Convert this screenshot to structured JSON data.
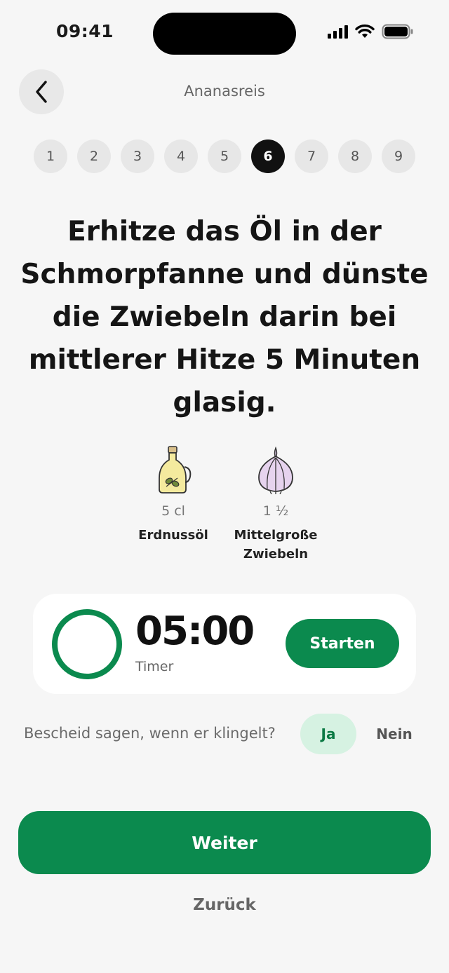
{
  "status_bar": {
    "time": "09:41",
    "icons": [
      "cellular-signal-icon",
      "wifi-icon",
      "battery-icon"
    ]
  },
  "header": {
    "back_icon": "chevron-left-icon",
    "title": "Ananasreis"
  },
  "steps": {
    "items": [
      "1",
      "2",
      "3",
      "4",
      "5",
      "6",
      "7",
      "8",
      "9"
    ],
    "active": "6"
  },
  "instruction": "Erhitze das Öl in der Schmorpfanne und dünste die Zwiebeln darin bei mittlerer Hitze 5 Minuten glasig.",
  "ingredients": [
    {
      "icon": "oil-bottle-icon",
      "quantity": "5 cl",
      "name": "Erdnussöl"
    },
    {
      "icon": "onion-icon",
      "quantity": "1 ½",
      "name": "Mittelgroße Zwiebeln"
    }
  ],
  "timer": {
    "value": "05:00",
    "label": "Timer",
    "start_label": "Starten"
  },
  "notify": {
    "question": "Bescheid sagen, wenn er klingelt?",
    "yes_label": "Ja",
    "no_label": "Nein"
  },
  "footer": {
    "next_label": "Weiter",
    "back_label": "Zurück"
  },
  "colors": {
    "accent": "#0b8a4e",
    "accent_light": "#d6f2e2",
    "background": "#f6f6f6"
  }
}
